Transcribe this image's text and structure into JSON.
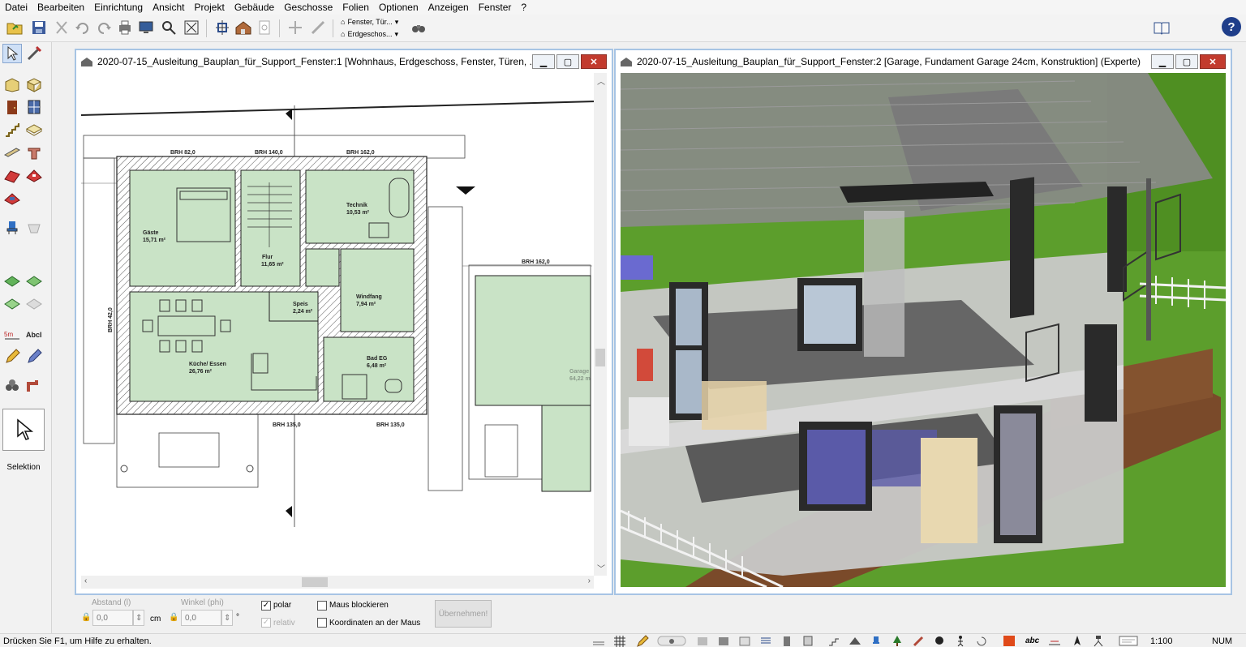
{
  "menu": [
    "Datei",
    "Bearbeiten",
    "Einrichtung",
    "Ansicht",
    "Projekt",
    "Gebäude",
    "Geschosse",
    "Folien",
    "Optionen",
    "Anzeigen",
    "Fenster",
    "?"
  ],
  "toolbar": {
    "combo_top": "Fenster, Tür...",
    "combo_bottom": "Erdgeschos...",
    "help": "?"
  },
  "palette": {
    "selection_label": "Selektion"
  },
  "window1": {
    "title": "2020-07-15_Ausleitung_Bauplan_für_Support_Fenster:1 [Wohnhaus, Erdgeschoss, Fenster, Türen, ...",
    "plan": {
      "rooms": [
        {
          "name": "Gäste",
          "area": "15,71 m²"
        },
        {
          "name": "Flur",
          "area": "11,65 m²"
        },
        {
          "name": "Technik",
          "area": "10,53 m²"
        },
        {
          "name": "Windfang",
          "area": "7,94 m²"
        },
        {
          "name": "Speis",
          "area": "2,24 m²"
        },
        {
          "name": "Küche/ Essen",
          "area": "26,76 m²"
        },
        {
          "name": "Bad EG",
          "area": "6,48 m²"
        },
        {
          "name": "Garage",
          "area": "64,22 m"
        }
      ],
      "brh": [
        "BRH 82,0",
        "BRH 140,0",
        "BRH 162,0",
        "BRH 162,0",
        "BRH 135,0",
        "BRH 135,0",
        "BRH 42,0"
      ]
    }
  },
  "window2": {
    "title": "2020-07-15_Ausleitung_Bauplan_für_Support_Fenster:2 [Garage, Fundament Garage 24cm, Konstruktion] (Experte)"
  },
  "inputs": {
    "distance_label": "Abstand (l)",
    "distance_value": "0,0",
    "distance_unit": "cm",
    "angle_label": "Winkel (phi)",
    "angle_value": "0,0",
    "angle_unit": "°",
    "polar": "polar",
    "relative": "relativ",
    "lock_mouse": "Maus blockieren",
    "snap_coords": "Koordinaten an der Maus",
    "apply": "Übernehmen!"
  },
  "status": {
    "help_text": "Drücken Sie F1, um Hilfe zu erhalten.",
    "abc": "abc",
    "scale": "1:100",
    "num": "NUM"
  },
  "colors": {
    "room_fill": "#c9e3c6",
    "window_border": "#a7c4e4",
    "close": "#c23b2e",
    "lawn": "#5c9e2c",
    "deck": "#7a4a2a",
    "roof": "#8a8a8a"
  }
}
